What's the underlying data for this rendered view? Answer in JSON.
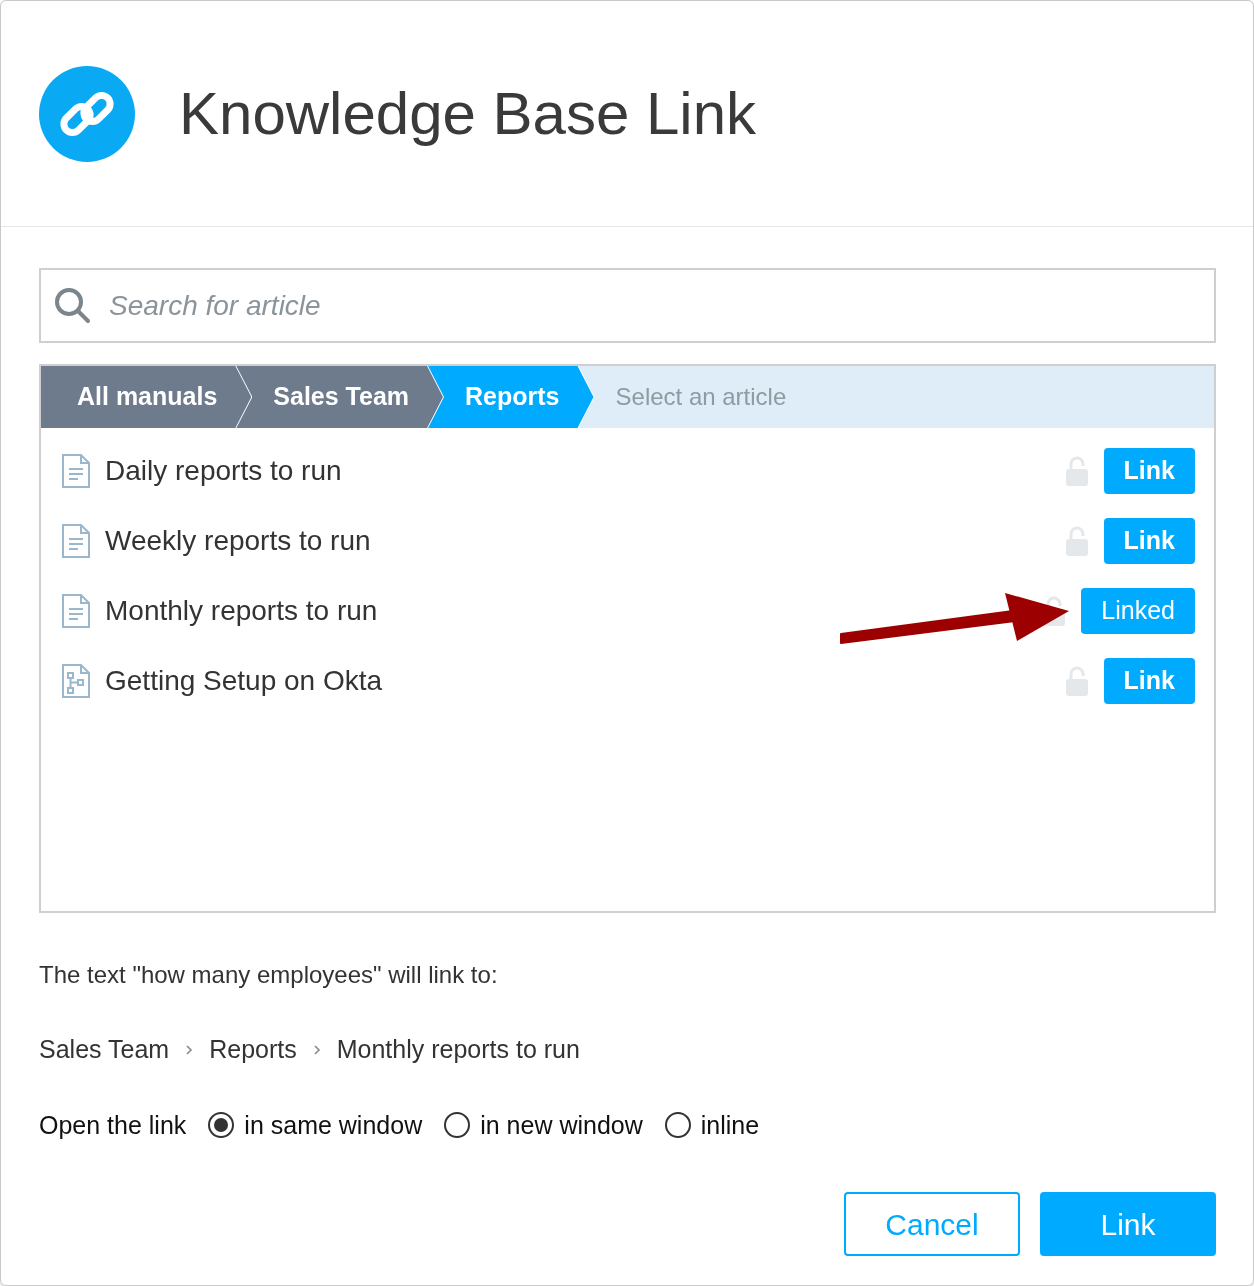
{
  "dialog": {
    "title": "Knowledge Base Link"
  },
  "search": {
    "placeholder": "Search for article"
  },
  "breadcrumb": [
    {
      "label": "All manuals",
      "selected": false
    },
    {
      "label": "Sales Team",
      "selected": false
    },
    {
      "label": "Reports",
      "selected": true
    },
    {
      "label": "Select an article",
      "kind": "hint"
    }
  ],
  "articles": [
    {
      "kind": "document",
      "title": "Daily reports to run",
      "button": "Link",
      "linked": false
    },
    {
      "kind": "document",
      "title": "Weekly reports to run",
      "button": "Link",
      "linked": false
    },
    {
      "kind": "document",
      "title": "Monthly reports to run",
      "button": "Linked",
      "linked": true
    },
    {
      "kind": "diagram",
      "title": "Getting Setup on Okta",
      "button": "Link",
      "linked": false
    }
  ],
  "link_text": "The text \"how many employees\" will link to:",
  "link_path": [
    "Sales Team",
    "Reports",
    "Monthly reports to run"
  ],
  "open_mode": {
    "label": "Open the link",
    "options": [
      {
        "label": "in same window",
        "selected": true
      },
      {
        "label": "in new window",
        "selected": false
      },
      {
        "label": "inline",
        "selected": false
      }
    ]
  },
  "buttons": [
    {
      "label": "Cancel",
      "kind": "secondary"
    },
    {
      "label": "Link",
      "kind": "primary"
    }
  ]
}
